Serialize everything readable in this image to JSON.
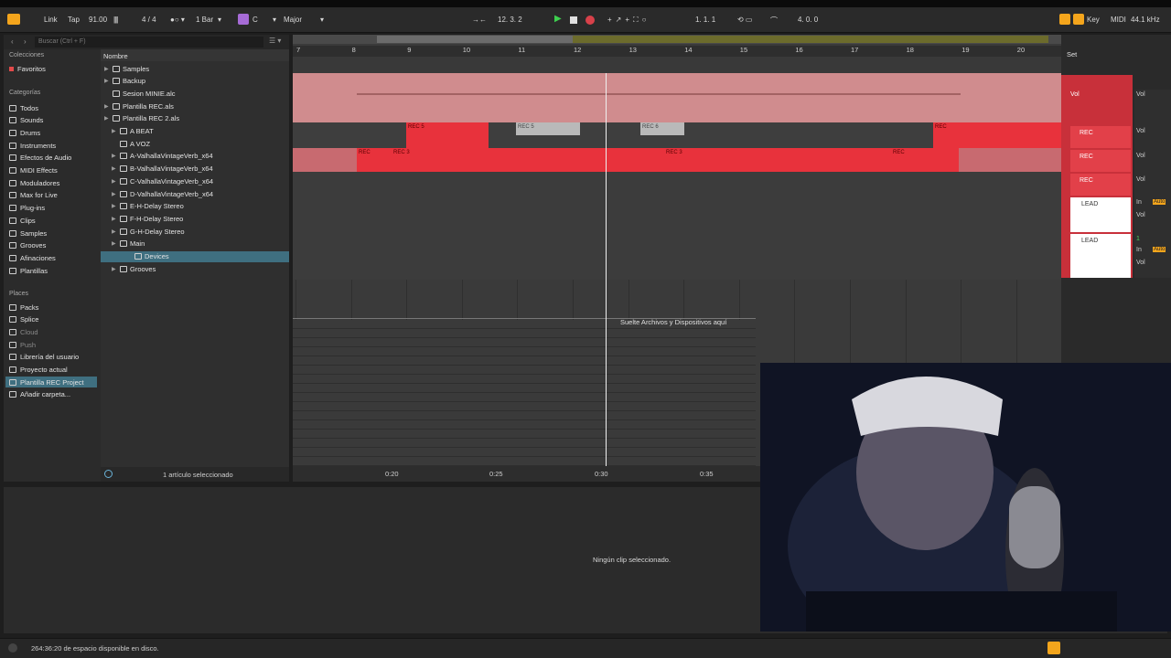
{
  "toolbar": {
    "link": "Link",
    "tap": "Tap",
    "tempo": "91.00",
    "metronome_icon": "metronome-icon",
    "signature": "4 / 4",
    "quantize": "1 Bar",
    "key": "C",
    "scale": "Major",
    "position": "12.  3.  2",
    "loop_start": "1.  1.  1",
    "loop_length": "4.  0.  0",
    "key_map": "Key",
    "midi_map": "MIDI",
    "sample_rate": "44.1 kHz"
  },
  "browser": {
    "search_placeholder": "Buscar (Ctrl + F)",
    "col_header": "Nombre",
    "collections_title": "Colecciones",
    "collections": [
      {
        "label": "Favoritos"
      }
    ],
    "categories_title": "Categorías",
    "categories": [
      {
        "label": "Todos"
      },
      {
        "label": "Sounds"
      },
      {
        "label": "Drums"
      },
      {
        "label": "Instruments"
      },
      {
        "label": "Efectos de Audio"
      },
      {
        "label": "MIDI Effects"
      },
      {
        "label": "Moduladores"
      },
      {
        "label": "Max for Live"
      },
      {
        "label": "Plug-ins"
      },
      {
        "label": "Clips"
      },
      {
        "label": "Samples"
      },
      {
        "label": "Grooves"
      },
      {
        "label": "Afinaciones"
      },
      {
        "label": "Plantillas"
      }
    ],
    "places_title": "Places",
    "places": [
      {
        "label": "Packs"
      },
      {
        "label": "Splice"
      },
      {
        "label": "Cloud"
      },
      {
        "label": "Push"
      },
      {
        "label": "Librería del usuario"
      },
      {
        "label": "Proyecto actual"
      },
      {
        "label": "Plantilla REC Project"
      },
      {
        "label": "Añadir carpeta..."
      }
    ],
    "files": [
      {
        "label": "Samples"
      },
      {
        "label": "Backup"
      },
      {
        "label": "Sesion MINIE.alc"
      },
      {
        "label": "Plantilla REC.als"
      },
      {
        "label": "Plantilla REC 2.als"
      },
      {
        "label": "A BEAT"
      },
      {
        "label": "A VOZ"
      },
      {
        "label": "A-ValhallaVintageVerb_x64"
      },
      {
        "label": "B-ValhallaVintageVerb_x64"
      },
      {
        "label": "C-ValhallaVintageVerb_x64"
      },
      {
        "label": "D-ValhallaVintageVerb_x64"
      },
      {
        "label": "E-H-Delay Stereo"
      },
      {
        "label": "F-H-Delay Stereo"
      },
      {
        "label": "G-H-Delay Stereo"
      },
      {
        "label": "Main"
      },
      {
        "label": "Devices"
      },
      {
        "label": "Grooves"
      }
    ],
    "footer": "1 artículo seleccionado"
  },
  "arrangement": {
    "bars": [
      "7",
      "8",
      "9",
      "10",
      "11",
      "12",
      "13",
      "14",
      "15",
      "16",
      "17",
      "18",
      "19",
      "20"
    ],
    "time_labels": [
      "0:20",
      "0:25",
      "0:30",
      "0:35"
    ],
    "drop_hint": "Suelte Archivos y Dispositivos aquí",
    "clips": {
      "rec5a": "REC 5",
      "rec5b": "REC 5",
      "rec6": "REC 6",
      "rec7": "REC",
      "rec_long_a": "REC",
      "rec_long_b": "REC 3",
      "rec_long_c": "REC 3",
      "rec_long_d": "REC"
    }
  },
  "side": {
    "set": "Set",
    "vol": "Vol",
    "rec": "REC",
    "lead": "LEAD",
    "in": "In",
    "auto": "Auto",
    "one": "1"
  },
  "detail": {
    "empty": "Ningún clip seleccionado."
  },
  "status": {
    "disk": "264:36:20 de espacio disponible en disco."
  }
}
